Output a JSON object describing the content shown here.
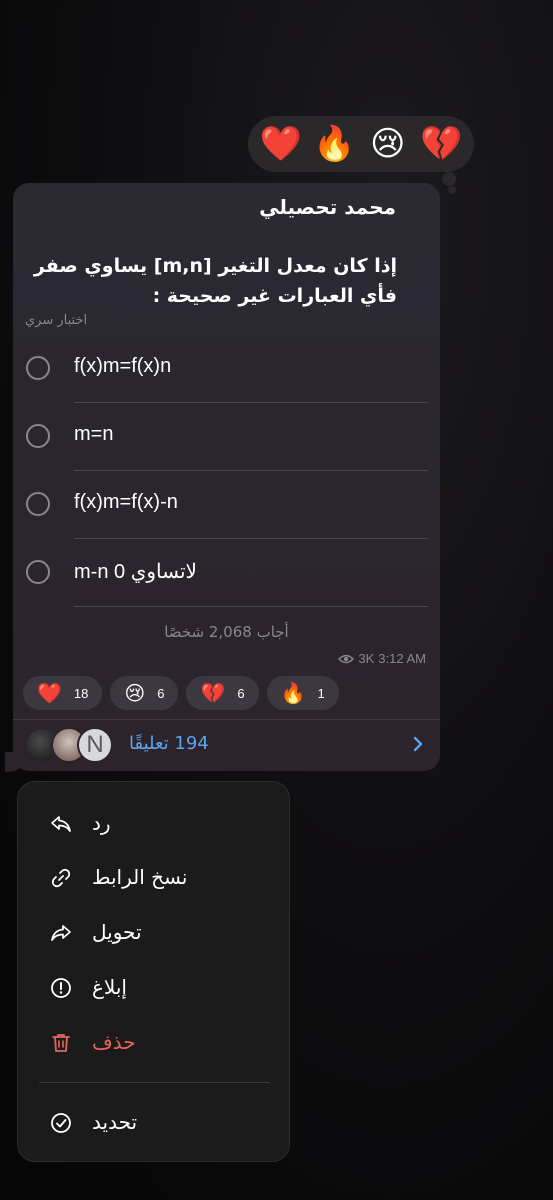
{
  "reaction_picker": {
    "emojis": [
      "❤️",
      "🔥",
      "😢",
      "💔"
    ]
  },
  "message": {
    "author": "محمد تحصيلي",
    "question": "إذا كان معدل التغير [m,n] يساوي صفر فأي العبارات غير صحيحة :",
    "quiz_type": "اختبار سري",
    "options": [
      {
        "label": "f(x)m=f(x)n"
      },
      {
        "label": "m=n"
      },
      {
        "label": "f(x)m=f(x)-n"
      },
      {
        "label": "لاتساوي 0 m-n"
      }
    ],
    "answered": "أجاب 2,068 شخصًا",
    "views": "3K",
    "time": "3:12 AM",
    "reactions": [
      {
        "emoji": "❤️",
        "count": "18"
      },
      {
        "emoji": "😢",
        "count": "6"
      },
      {
        "emoji": "💔",
        "count": "6"
      },
      {
        "emoji": "🔥",
        "count": "1"
      }
    ],
    "comments": {
      "label": "194 تعليقًا",
      "avatar_letter": "N"
    }
  },
  "menu": {
    "items": [
      {
        "label": "رد",
        "icon": "reply-icon"
      },
      {
        "label": "نسخ الرابط",
        "icon": "link-icon"
      },
      {
        "label": "تحويل",
        "icon": "forward-icon"
      },
      {
        "label": "إبلاغ",
        "icon": "report-icon"
      },
      {
        "label": "حذف",
        "icon": "trash-icon"
      },
      {
        "label": "تحديد",
        "icon": "select-icon"
      }
    ]
  },
  "colors": {
    "accent_link": "#5aa5f0",
    "danger": "#e4665a"
  }
}
